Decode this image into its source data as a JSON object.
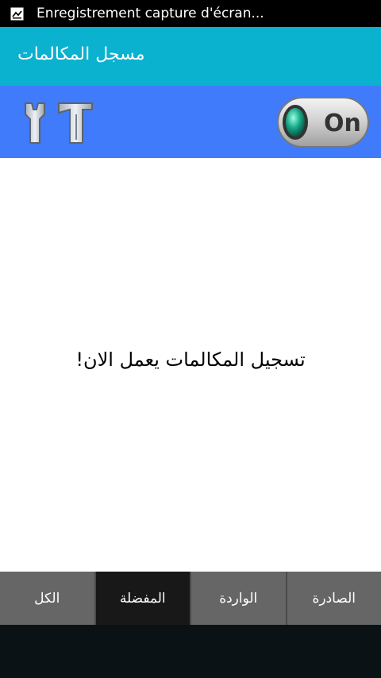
{
  "status_bar": {
    "notification_icon": "screen-record-icon",
    "text": "Enregistrement capture d'écran..."
  },
  "app_bar": {
    "title": "مسجل المكالمات"
  },
  "toolbar": {
    "tools_icon": "tools-icon",
    "toggle_label": "On",
    "toggle_state": "on"
  },
  "main": {
    "status_message": "تسجيل المكالمات يعمل الان!"
  },
  "tabs": [
    {
      "label": "الكل",
      "active": false
    },
    {
      "label": "المفضلة",
      "active": true
    },
    {
      "label": "الواردة",
      "active": false
    },
    {
      "label": "الصادرة",
      "active": false
    }
  ],
  "colors": {
    "app_bar": "#0ab2cf",
    "toolbar": "#3f7bfb",
    "tab_bg": "#666666",
    "tab_active": "#181818"
  }
}
